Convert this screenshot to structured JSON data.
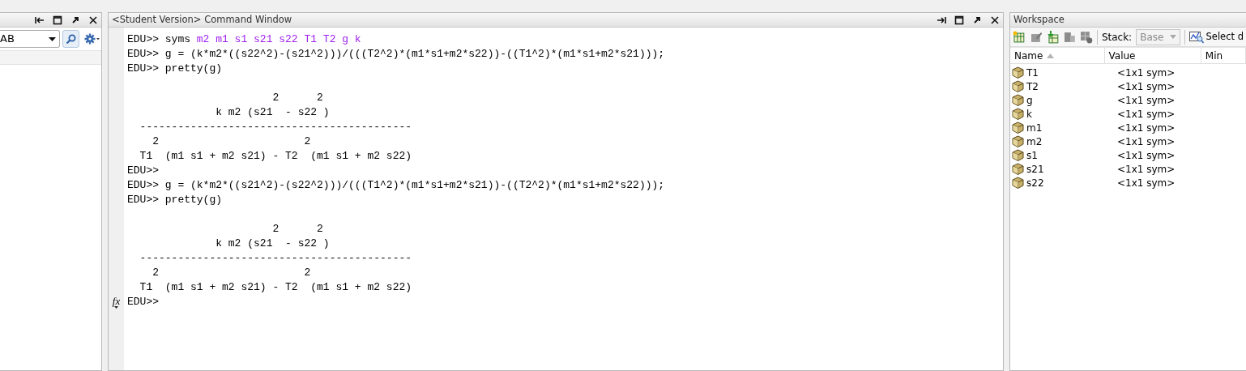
{
  "left_panel": {
    "folder_combo": {
      "value": "AB"
    }
  },
  "command_window": {
    "title": "<Student Version> Command Window",
    "lines": [
      {
        "kind": "input",
        "text": "EDU>> syms",
        "args": "m2 m1 s1 s21 s22 T1 T2 g k"
      },
      {
        "kind": "input",
        "text": "EDU>> g = (k*m2*((s22^2)-(s21^2)))/(((T2^2)*(m1*s1+m2*s22))-((T1^2)*(m1*s1+m2*s21)));"
      },
      {
        "kind": "input",
        "text": "EDU>> pretty(g)"
      },
      {
        "kind": "blank"
      },
      {
        "kind": "output",
        "text": "                       2      2"
      },
      {
        "kind": "output",
        "text": "              k m2 (s21  - s22 )"
      },
      {
        "kind": "output",
        "text": "  -------------------------------------------"
      },
      {
        "kind": "output",
        "text": "    2                       2"
      },
      {
        "kind": "output",
        "text": "  T1  (m1 s1 + m2 s21) - T2  (m1 s1 + m2 s22)"
      },
      {
        "kind": "input",
        "text": "EDU>>"
      },
      {
        "kind": "input",
        "text": "EDU>> g = (k*m2*((s21^2)-(s22^2)))/(((T1^2)*(m1*s1+m2*s21))-((T2^2)*(m1*s1+m2*s22)));"
      },
      {
        "kind": "input",
        "text": "EDU>> pretty(g)"
      },
      {
        "kind": "blank"
      },
      {
        "kind": "output",
        "text": "                       2      2"
      },
      {
        "kind": "output",
        "text": "              k m2 (s21  - s22 )"
      },
      {
        "kind": "output",
        "text": "  -------------------------------------------"
      },
      {
        "kind": "output",
        "text": "    2                       2"
      },
      {
        "kind": "output",
        "text": "  T1  (m1 s1 + m2 s21) - T2  (m1 s1 + m2 s22)"
      },
      {
        "kind": "input",
        "text": "EDU>>",
        "marker": "fx"
      }
    ]
  },
  "workspace": {
    "title": "Workspace",
    "stack_label": "Stack:",
    "stack": {
      "value": "Base",
      "disabled": true
    },
    "select_button": "Select d",
    "columns": [
      {
        "label": "Name",
        "sorted": true
      },
      {
        "label": "Value",
        "sorted": false
      },
      {
        "label": "Min",
        "sorted": false
      }
    ],
    "variables": [
      {
        "name": "T1",
        "value": "<1x1 sym>"
      },
      {
        "name": "T2",
        "value": "<1x1 sym>"
      },
      {
        "name": "g",
        "value": "<1x1 sym>"
      },
      {
        "name": "k",
        "value": "<1x1 sym>"
      },
      {
        "name": "m1",
        "value": "<1x1 sym>"
      },
      {
        "name": "m2",
        "value": "<1x1 sym>"
      },
      {
        "name": "s1",
        "value": "<1x1 sym>"
      },
      {
        "name": "s21",
        "value": "<1x1 sym>"
      },
      {
        "name": "s22",
        "value": "<1x1 sym>"
      }
    ]
  }
}
